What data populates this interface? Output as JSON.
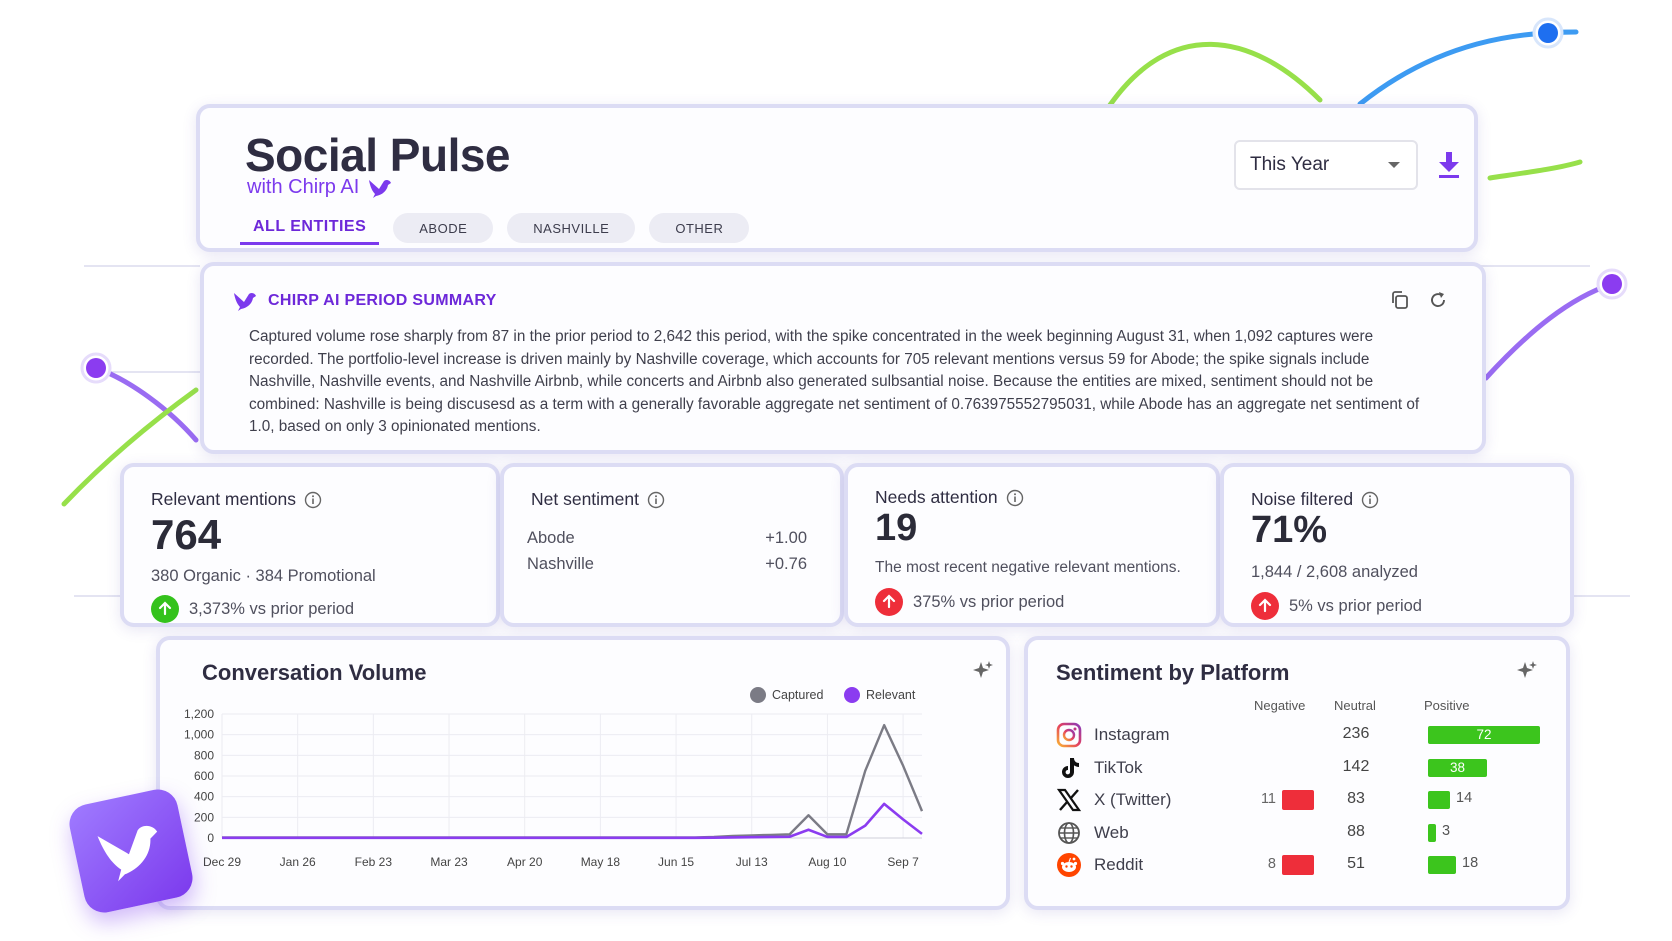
{
  "app": {
    "title": "Social Pulse",
    "subtitle": "with Chirp AI",
    "tabs": [
      {
        "label": "ALL ENTITIES",
        "active": true
      },
      {
        "label": "ABODE",
        "active": false
      },
      {
        "label": "NASHVILLE",
        "active": false
      },
      {
        "label": "OTHER",
        "active": false
      }
    ],
    "period_select": {
      "value": "This Year"
    },
    "download_icon": "download-icon",
    "accent_color": "#7c3aed"
  },
  "summary": {
    "title": "CHIRP AI PERIOD SUMMARY",
    "text": "Captured volume rose sharply from 87 in the prior period to 2,642 this period, with the spike concentrated in the week beginning August 31, when 1,092 captures were recorded. The portfolio-level increase is driven mainly by Nashville coverage, which accounts for 705 relevant mentions versus 59 for Abode; the spike signals include Nashville, Nashville events, and Nashville Airbnb, while concerts and Airbnb also generated sulbsantial noise. Because the entities are mixed, sentiment should not be combined: Nashville is being discusesd as a term with a generally favorable aggregate net sentiment of 0.763975552795031, while Abode has an aggregate net sentiment of 1.0, based on only 3 opinionated mentions.",
    "copy_icon": "copy-icon",
    "refresh_icon": "refresh-icon"
  },
  "metrics": {
    "relevant": {
      "label": "Relevant mentions",
      "value": "764",
      "sub": "380 Organic · 384 Promotional",
      "change": "3,373% vs prior period",
      "direction": "up",
      "color": "#34c21c"
    },
    "sentiment": {
      "label": "Net sentiment",
      "rows": [
        {
          "name": "Abode",
          "value": "+1.00"
        },
        {
          "name": "Nashville",
          "value": "+0.76"
        }
      ]
    },
    "attention": {
      "label": "Needs attention",
      "value": "19",
      "sub": "The most recent negative relevant mentions.",
      "change": "375% vs prior period",
      "direction": "up",
      "color": "#ee2e3a"
    },
    "noise": {
      "label": "Noise filtered",
      "value": "71%",
      "sub": "1,844 / 2,608 analyzed",
      "change": "5% vs prior period",
      "direction": "up",
      "color": "#ee2e3a"
    }
  },
  "volume": {
    "title": "Conversation Volume",
    "legend": [
      {
        "name": "Captured",
        "color": "#7b7b85"
      },
      {
        "name": "Relevant",
        "color": "#8b3cf0"
      }
    ],
    "chart_data": {
      "type": "line",
      "title": "Conversation Volume",
      "x": [
        "Dec 29",
        "Jan 5",
        "Jan 12",
        "Jan 19",
        "Jan 26",
        "Feb 2",
        "Feb 9",
        "Feb 16",
        "Feb 23",
        "Mar 2",
        "Mar 9",
        "Mar 16",
        "Mar 23",
        "Mar 30",
        "Apr 6",
        "Apr 13",
        "Apr 20",
        "Apr 27",
        "May 4",
        "May 11",
        "May 18",
        "May 25",
        "Jun 1",
        "Jun 8",
        "Jun 15",
        "Jun 22",
        "Jun 29",
        "Jul 6",
        "Jul 13",
        "Jul 20",
        "Jul 27",
        "Aug 3",
        "Aug 10",
        "Aug 17",
        "Aug 24",
        "Aug 31",
        "Sep 7",
        "Sep 14"
      ],
      "x_tick_labels": [
        "Dec 29",
        "Jan 26",
        "Feb 23",
        "Mar 23",
        "Apr 20",
        "May 18",
        "Jun 15",
        "Jul 13",
        "Aug 10",
        "Sep 7"
      ],
      "y_ticks": [
        "0",
        "200",
        "400",
        "600",
        "800",
        "1,000",
        "1,200"
      ],
      "ylim": [
        0,
        1200
      ],
      "grid": true,
      "legend_position": "top-right",
      "series": [
        {
          "name": "Captured",
          "values": [
            5,
            5,
            5,
            5,
            5,
            5,
            5,
            5,
            5,
            5,
            5,
            5,
            5,
            5,
            5,
            5,
            5,
            5,
            5,
            5,
            5,
            5,
            5,
            5,
            5,
            5,
            10,
            20,
            25,
            30,
            35,
            220,
            35,
            35,
            650,
            1092,
            700,
            260
          ]
        },
        {
          "name": "Relevant",
          "values": [
            2,
            2,
            2,
            2,
            2,
            2,
            2,
            2,
            2,
            2,
            2,
            2,
            2,
            2,
            2,
            2,
            2,
            2,
            2,
            2,
            2,
            2,
            2,
            2,
            2,
            2,
            3,
            5,
            8,
            10,
            12,
            80,
            10,
            10,
            120,
            330,
            180,
            40
          ]
        }
      ]
    }
  },
  "platforms": {
    "title": "Sentiment by Platform",
    "columns": [
      "Negative",
      "Neutral",
      "Positive"
    ],
    "rows": [
      {
        "name": "Instagram",
        "icon": "instagram-icon",
        "negative": null,
        "neutral": "236",
        "positive": 72
      },
      {
        "name": "TikTok",
        "icon": "tiktok-icon",
        "negative": null,
        "neutral": "142",
        "positive": 38
      },
      {
        "name": "X (Twitter)",
        "icon": "x-twitter-icon",
        "negative": 11,
        "neutral": "83",
        "positive": 14
      },
      {
        "name": "Web",
        "icon": "globe-icon",
        "negative": null,
        "neutral": "88",
        "positive": 3
      },
      {
        "name": "Reddit",
        "icon": "reddit-icon",
        "negative": 8,
        "neutral": "51",
        "positive": 18
      }
    ],
    "negative_color": "#ee2e3a",
    "positive_color": "#3cc51d"
  },
  "logo_icon": "bird-icon"
}
